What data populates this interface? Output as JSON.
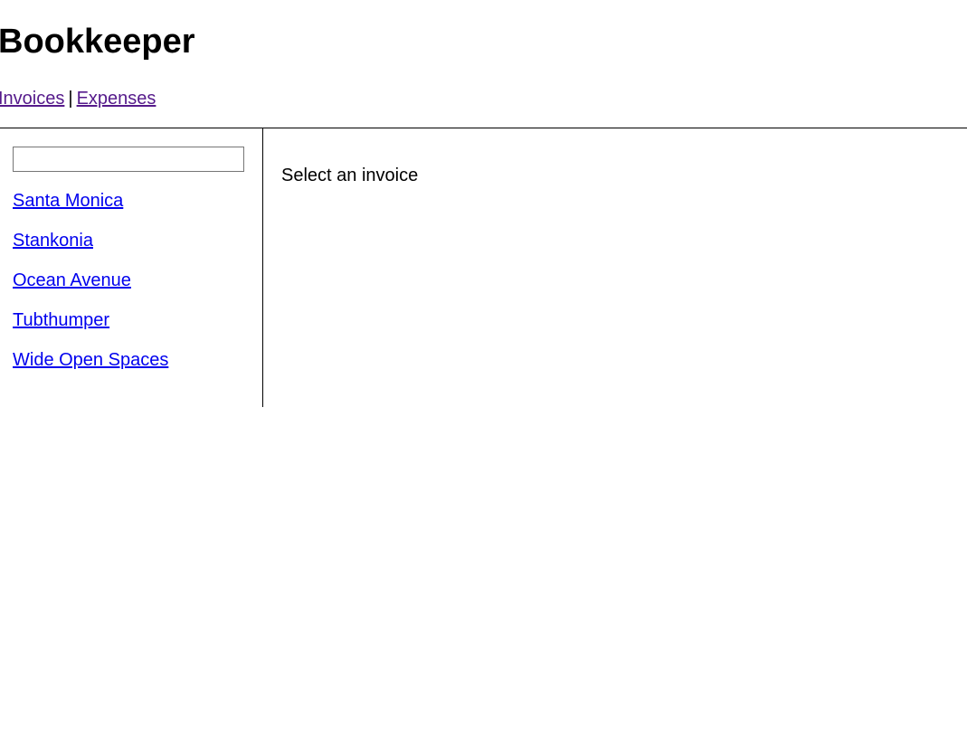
{
  "header": {
    "title": "Bookkeeper"
  },
  "nav": {
    "invoices_label": "Invoices",
    "separator": "|",
    "expenses_label": "Expenses",
    "link_color_visited": "#551a8b"
  },
  "sidebar": {
    "search": {
      "value": "",
      "placeholder": ""
    },
    "link_color": "#0000ee",
    "invoices": [
      {
        "label": "Santa Monica"
      },
      {
        "label": "Stankonia"
      },
      {
        "label": "Ocean Avenue"
      },
      {
        "label": "Tubthumper"
      },
      {
        "label": "Wide Open Spaces"
      }
    ]
  },
  "main": {
    "message": "Select an invoice"
  }
}
